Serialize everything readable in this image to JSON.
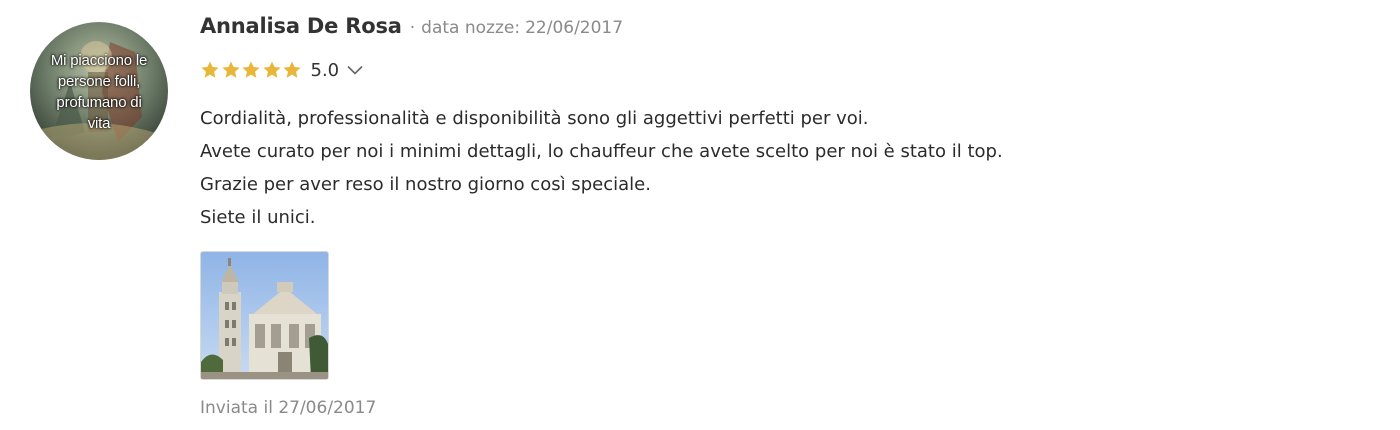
{
  "review": {
    "avatar_text": [
      "Mi piacciono le",
      "persone folli,",
      "profumano di",
      "vita"
    ],
    "author": "Annalisa De Rosa",
    "separator": "·",
    "wedding_label": "data nozze:",
    "wedding_date": "22/06/2017",
    "rating": {
      "value": "5.0",
      "stars_filled": 5,
      "stars_total": 5,
      "star_color": "#e8b73a"
    },
    "lines": [
      "Cordialità, professionalità e disponibilità sono gli aggettivi perfetti per voi.",
      "Avete curato per noi i minimi dettagli, lo chauffeur che avete scelto per noi è stato il top.",
      "Grazie per aver reso il nostro giorno così speciale.",
      "Siete il unici."
    ],
    "sent_label": "Inviata il 27/06/2017"
  },
  "icons": {
    "star": "star-icon",
    "chevron": "chevron-down-icon"
  }
}
